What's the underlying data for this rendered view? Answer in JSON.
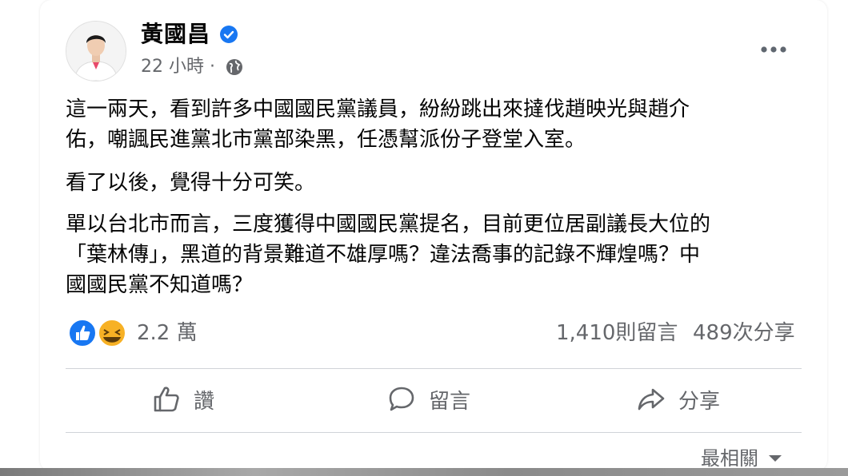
{
  "post": {
    "author": "黃國昌",
    "time": "22 小時",
    "time_separator": "·",
    "paragraphs": [
      "這一兩天，看到許多中國國民黨議員，紛紛跳出來撻伐趙映光與趙介",
      "佑，嘲諷民進黨北市黨部染黑，任憑幫派份子登堂入室。",
      "看了以後，覺得十分可笑。",
      "單以台北市而言，三度獲得中國國民黨提名，目前更位居副議長大位的",
      "「葉林傳」，黑道的背景難道不雄厚嗎？違法喬事的記錄不輝煌嗎？中",
      "國國民黨不知道嗎？"
    ]
  },
  "stats": {
    "reactions": "2.2 萬",
    "comments": "1,410則留言",
    "shares": "489次分享"
  },
  "actions": {
    "like": "讚",
    "comment": "留言",
    "share": "分享"
  },
  "sort": {
    "label": "最相關"
  },
  "colors": {
    "verified": "#1877f2",
    "like_reaction": "#1877f2",
    "haha_reaction": "#f7b125",
    "secondary_text": "#65676b"
  },
  "icons": {
    "verified": "verified-badge-icon",
    "audience": "globe-icon",
    "more": "more-options-icon",
    "like": "thumbs-up-icon",
    "comment": "comment-bubble-icon",
    "share": "share-arrow-icon",
    "sort": "caret-down-icon"
  }
}
